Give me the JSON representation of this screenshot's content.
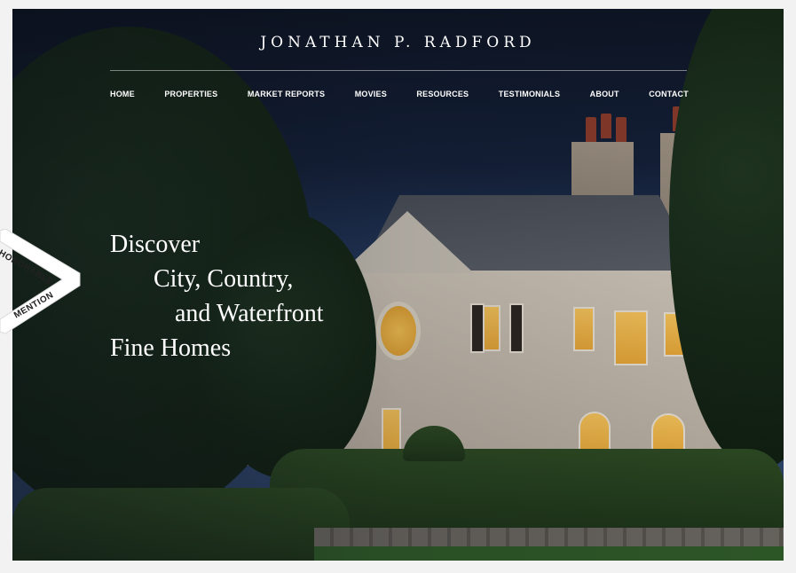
{
  "header": {
    "brand": "JONATHAN P. RADFORD"
  },
  "nav": {
    "items": [
      {
        "label": "HOME"
      },
      {
        "label": "PROPERTIES"
      },
      {
        "label": "MARKET REPORTS"
      },
      {
        "label": "MOVIES"
      },
      {
        "label": "RESOURCES"
      },
      {
        "label": "TESTIMONIALS"
      },
      {
        "label": "ABOUT"
      },
      {
        "label": "CONTACT"
      }
    ]
  },
  "hero": {
    "line1": "Discover",
    "line2": "City, Country,",
    "line3": "and Waterfront",
    "line4": "Fine Homes"
  },
  "award": {
    "line1": "HONORABLE",
    "line2": "MENTION"
  },
  "colors": {
    "text": "#ffffff",
    "sky_top": "#0d1423",
    "sky_bottom": "#2f4a74",
    "window_glow": "#f7c45a",
    "foliage": "#1d3318"
  }
}
